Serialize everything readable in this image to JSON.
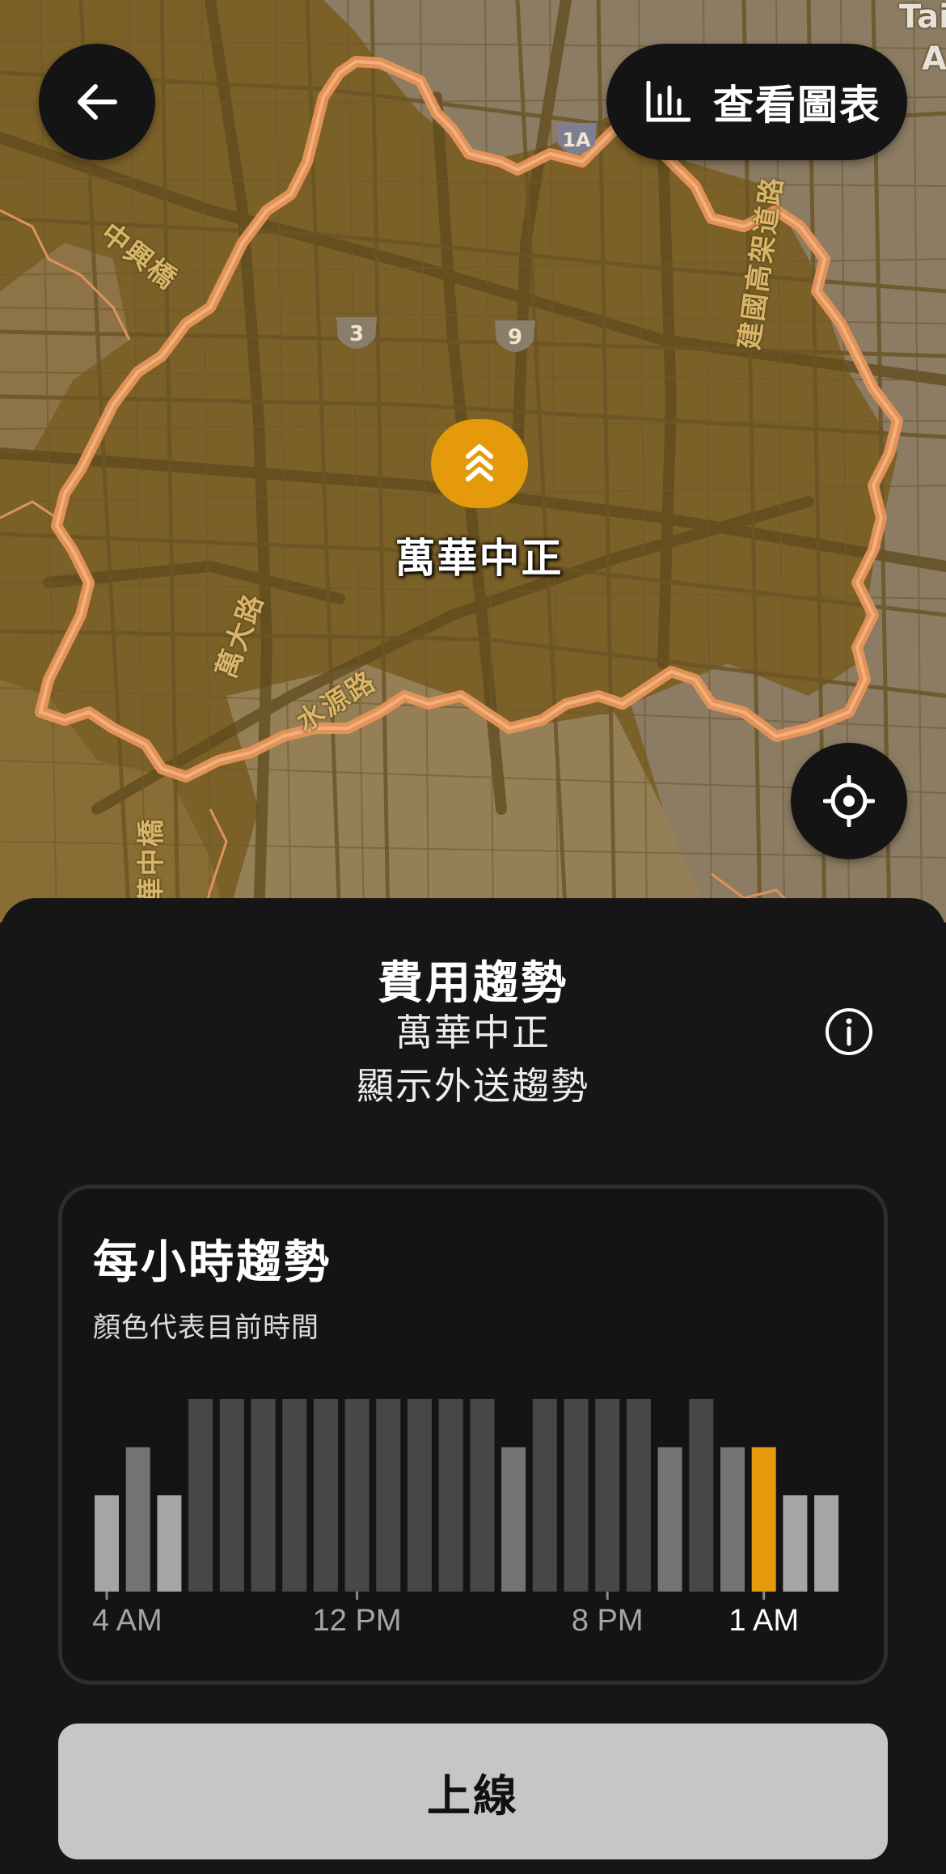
{
  "map": {
    "zone_name": "萬華中正",
    "road_labels": [
      "中興橋",
      "建國高架道路",
      "萬大路",
      "水源路",
      "華中橋"
    ],
    "corner_label_top": "Tai",
    "corner_label_bottom": "A",
    "route_shields": [
      "3",
      "9",
      "1A"
    ],
    "accent_color": "#e49a0a",
    "zone_border_color": "#e8955a"
  },
  "header": {
    "back_icon": "arrow-left-icon",
    "chart_button_label": "查看圖表",
    "chart_icon": "bar-chart-icon"
  },
  "sheet": {
    "title": "費用趨勢",
    "subtitle_zone": "萬華中正",
    "subtitle_mode": "顯示外送趨勢",
    "info_icon": "info-icon"
  },
  "hourly_card": {
    "title": "每小時趨勢",
    "subtitle": "顏色代表目前時間"
  },
  "chart_data": {
    "type": "bar",
    "title": "每小時趨勢",
    "tick_labels": [
      "4 AM",
      "12 PM",
      "8 PM",
      "1 AM"
    ],
    "tick_bar_index": [
      0,
      8,
      16,
      21
    ],
    "current_label": "1 AM",
    "current_bar_index": 21,
    "values": [
      2,
      3,
      2,
      4,
      4,
      4,
      4,
      4,
      4,
      4,
      4,
      4,
      4,
      3,
      4,
      4,
      4,
      4,
      3,
      4,
      3,
      3,
      2,
      2
    ],
    "ylim": [
      0,
      4
    ],
    "bar_colors": [
      "#a5a5a5",
      "#737373",
      "#a5a5a5",
      "#474747",
      "#474747",
      "#474747",
      "#474747",
      "#474747",
      "#474747",
      "#474747",
      "#474747",
      "#474747",
      "#474747",
      "#737373",
      "#474747",
      "#474747",
      "#474747",
      "#474747",
      "#737373",
      "#474747",
      "#737373",
      "#e49a0a",
      "#a5a5a5",
      "#a5a5a5"
    ]
  },
  "footer": {
    "online_button_label": "上線"
  }
}
